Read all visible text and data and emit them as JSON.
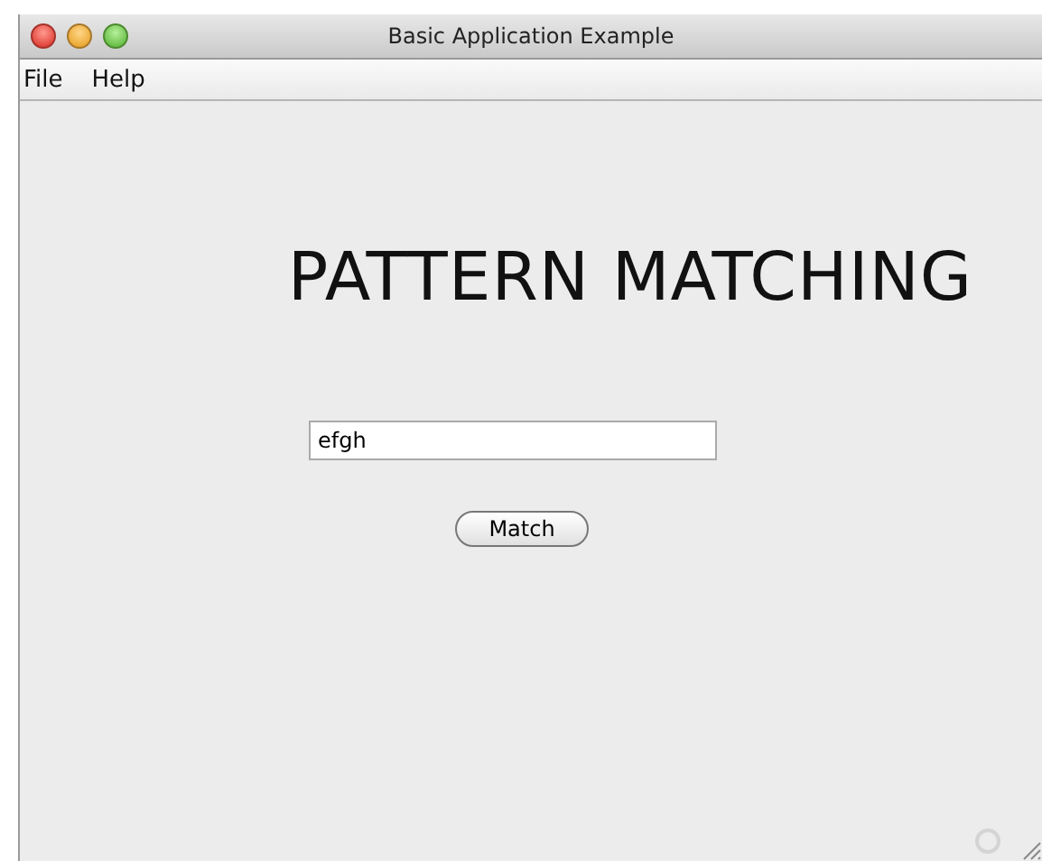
{
  "window": {
    "title": "Basic Application Example"
  },
  "menu": [
    {
      "label": "File"
    },
    {
      "label": "Help"
    }
  ],
  "heading": "PATTERN MATCHING",
  "pattern_field": {
    "value": "efgh"
  },
  "match_button": {
    "label": "Match"
  }
}
